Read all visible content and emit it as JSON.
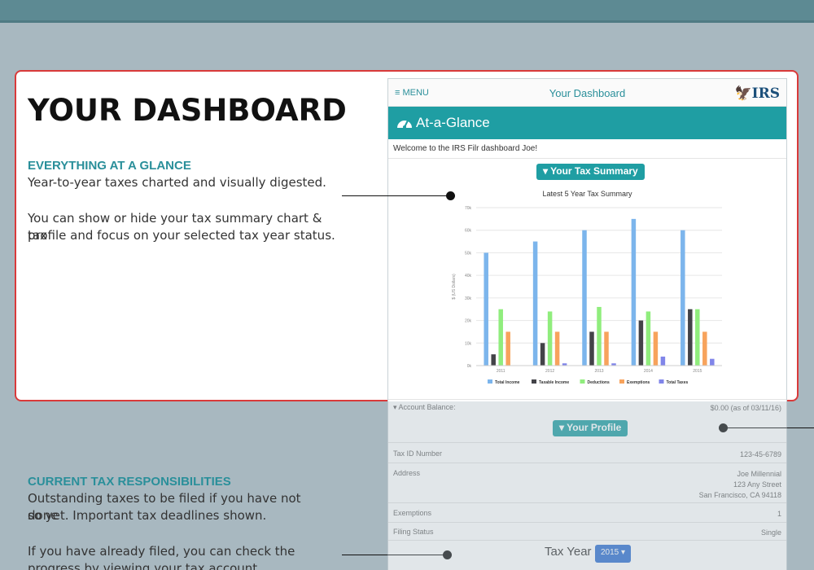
{
  "slide": {
    "title": "YOUR DASHBOARD",
    "section1": {
      "heading": "EVERYTHING  AT A GLANCE",
      "line1": "Year-to-year taxes charted and visually digested.",
      "line2a": "You can show or hide your tax summary chart & tax",
      "line2b": "profile and focus on your selected tax year status."
    },
    "section2": {
      "heading": "CURRENT TAX RESPONSIBILITIES",
      "line1a": "Outstanding taxes to be filed if you have not done",
      "line1b": "so yet. Important tax deadlines shown.",
      "line2a": "If  you  have  already  filed,  you  can  check  the",
      "line2b": "progress by viewing your tax account transcripts or"
    }
  },
  "app": {
    "menu_label": "≡ MENU",
    "header_title": "Your Dashboard",
    "logo": "IRS",
    "glance_title": "At-a-Glance",
    "welcome": "Welcome to the IRS Filr dashboard Joe!",
    "summary_button": "▾ Your Tax Summary",
    "account_balance_label": "▾ Account Balance:",
    "account_balance_value": "$0.00 (as of 03/11/16)",
    "profile_button": "▾ Your Profile",
    "profile": {
      "tax_id_label": "Tax ID Number",
      "tax_id_value": "123-45-6789",
      "address_label": "Address",
      "address_line1": "Joe Millennial",
      "address_line2": "123 Any Street",
      "address_line3": "San Francisco, CA 94118",
      "exemptions_label": "Exemptions",
      "exemptions_value": "1",
      "filing_status_label": "Filing Status",
      "filing_status_value": "Single"
    },
    "tax_year_label": "Tax Year",
    "tax_year_selected": "2015 ▾"
  },
  "colors": {
    "teal": "#1f9ea3",
    "highlight_border": "#d93a3a",
    "blue_button": "#2e6fd1"
  },
  "chart_data": {
    "type": "bar",
    "title": "Latest 5 Year Tax Summary",
    "ylabel": "$ (US Dollars)",
    "ylim": [
      0,
      70000
    ],
    "yticks": [
      "0k",
      "10k",
      "20k",
      "30k",
      "40k",
      "50k",
      "60k",
      "70k"
    ],
    "categories": [
      "2011",
      "2012",
      "2013",
      "2014",
      "2015"
    ],
    "series": [
      {
        "name": "Total Income",
        "color": "#7cb5ec",
        "values": [
          50000,
          55000,
          60000,
          65000,
          60000
        ]
      },
      {
        "name": "Taxable Income",
        "color": "#434348",
        "values": [
          5000,
          10000,
          15000,
          20000,
          25000
        ]
      },
      {
        "name": "Deductions",
        "color": "#90ed7d",
        "values": [
          25000,
          24000,
          26000,
          24000,
          25000
        ]
      },
      {
        "name": "Exemptions",
        "color": "#f7a35c",
        "values": [
          15000,
          15000,
          15000,
          15000,
          15000
        ]
      },
      {
        "name": "Total Taxes",
        "color": "#8085e9",
        "values": [
          0,
          1000,
          1000,
          4000,
          3000
        ]
      }
    ],
    "legend": "bottom",
    "grid": true
  }
}
